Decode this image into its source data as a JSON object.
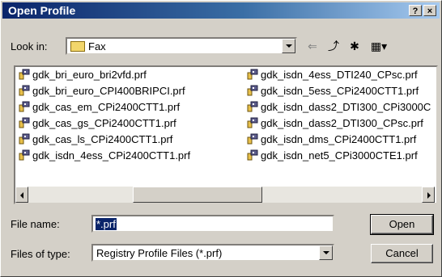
{
  "window": {
    "title": "Open Profile",
    "help_glyph": "?",
    "close_glyph": "×"
  },
  "look_in": {
    "label": "Look in:",
    "value": "Fax"
  },
  "toolbar": {
    "back_glyph": "⇐",
    "up_glyph": "⤴",
    "newfolder_glyph": "✱",
    "views_glyph": "▦▾"
  },
  "files": [
    "gdk_bri_euro_bri2vfd.prf",
    "gdk_bri_euro_CPI400BRIPCI.prf",
    "gdk_cas_em_CPi2400CTT1.prf",
    "gdk_cas_gs_CPi2400CTT1.prf",
    "gdk_cas_ls_CPi2400CTT1.prf",
    "gdk_isdn_4ess_CPi2400CTT1.prf",
    "gdk_isdn_4ess_DTI240_CPsc.prf",
    "gdk_isdn_5ess_CPi2400CTT1.prf",
    "gdk_isdn_dass2_DTI300_CPi3000C",
    "gdk_isdn_dass2_DTI300_CPsc.prf",
    "gdk_isdn_dms_CPi2400CTT1.prf",
    "gdk_isdn_net5_CPi3000CTE1.prf"
  ],
  "filename": {
    "label": "File name:",
    "value": "*.prf"
  },
  "filetype": {
    "label": "Files of type:",
    "value": "Registry Profile Files (*.prf)"
  },
  "buttons": {
    "open": "Open",
    "cancel": "Cancel"
  },
  "colors": {
    "title_start": "#0a246a",
    "title_end": "#a6caf0",
    "selection": "#0a246a"
  }
}
